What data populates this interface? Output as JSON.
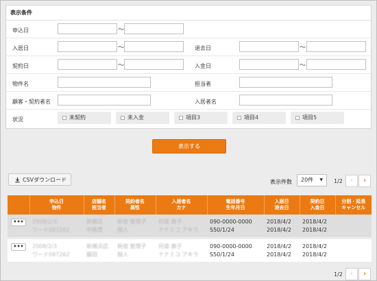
{
  "search": {
    "title": "表示条件",
    "labels": {
      "apply_date": "申込日",
      "move_in": "入居日",
      "move_out": "退去日",
      "contract_date": "契約日",
      "payment_date": "入金日",
      "property": "物件名",
      "staff": "担当者",
      "customer": "顧客・契約者名",
      "resident": "入居者名",
      "status": "状況"
    },
    "tilde": "〜",
    "status_options": [
      "未契約",
      "未入金",
      "項目3",
      "項目4",
      "項目5"
    ],
    "show_button": "表示する"
  },
  "toolbar": {
    "csv_label": "CSVダウンロード",
    "count_label": "表示件数",
    "count_value": "20件",
    "page": "1/2",
    "page_bottom": "1/2",
    "prev": "‹",
    "next": "›"
  },
  "table": {
    "headers": [
      "",
      "申込日\n物件",
      "店舗名\n担当者",
      "契約者名\n属性",
      "入居者名\nカナ",
      "電話番号\n生年月日",
      "入居日\n退去日",
      "契約日\n入金日",
      "分割・延長\nキャンセル"
    ],
    "rows": [
      {
        "more": "•••",
        "apply": "2008/2/3",
        "property": "ワード087262",
        "store": "新都店",
        "staff": "中務豊",
        "contractor": "新宿 管理子",
        "attr": "個人",
        "resident": "何道 鹿子",
        "kana": "ナナミコ アキラ",
        "phone": "090-0000-0000",
        "birth": "S50/1/24",
        "move_in": "2018/4/2",
        "move_out": "2018/4/2",
        "contract": "2018/4/2",
        "payment": "2018/4/2"
      },
      {
        "more": "•••",
        "apply": "2008/2/3",
        "property": "ワード087262",
        "store": "新横浜店",
        "staff": "藤田",
        "contractor": "新宿 管理子",
        "attr": "個人",
        "resident": "何道 鹿子",
        "kana": "ナナミコ アキラ",
        "phone": "090-0000-0000",
        "birth": "S50/1/24",
        "move_in": "2018/4/2",
        "move_out": "2018/4/2",
        "contract": "2018/4/2",
        "payment": "2018/4/2"
      }
    ]
  },
  "colors": {
    "accent": "#ec7a12"
  }
}
